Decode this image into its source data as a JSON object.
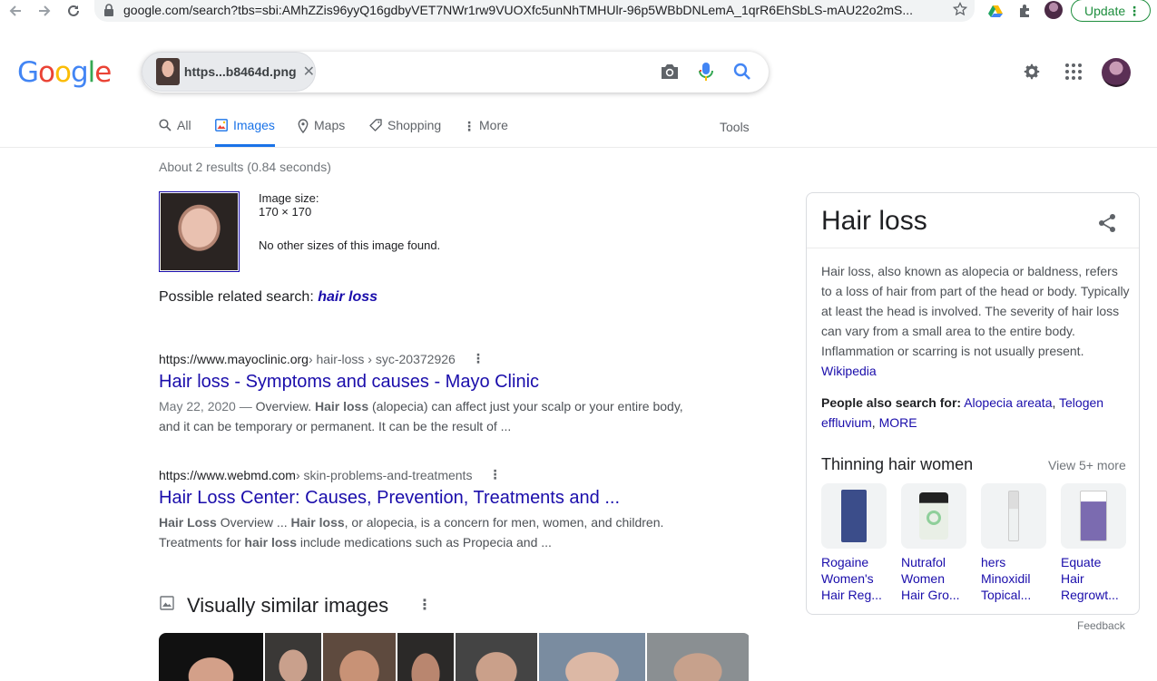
{
  "browser": {
    "url": "google.com/search?tbs=sbi:AMhZZis96yyQ16gdbyVET7NWr1rw9VUOXfc5unNhTMHUlr-96p5WBbDNLemA_1qrR6EhSbLS-mAU22o2mS...",
    "update_label": "Update"
  },
  "logo": [
    "G",
    "o",
    "o",
    "g",
    "l",
    "e"
  ],
  "logo_colors": [
    "#4285F4",
    "#EA4335",
    "#FBBC05",
    "#4285F4",
    "#34A853",
    "#EA4335"
  ],
  "search": {
    "chip_label": "https...b8464d.png"
  },
  "tabs": [
    {
      "label": "All",
      "icon": "search-icon"
    },
    {
      "label": "Images",
      "icon": "image-icon",
      "active": true
    },
    {
      "label": "Maps",
      "icon": "map-pin-icon"
    },
    {
      "label": "Shopping",
      "icon": "tag-icon"
    },
    {
      "label": "More",
      "icon": "kebab-icon"
    }
  ],
  "tools_label": "Tools",
  "result_stats": "About 2 results (0.84 seconds)",
  "query_image": {
    "size_label": "Image size:",
    "size_value": "170 × 170",
    "no_sizes": "No other sizes of this image found."
  },
  "related": {
    "prefix": "Possible related search: ",
    "query": "hair loss"
  },
  "results": [
    {
      "domain": "https://www.mayoclinic.org",
      "path": " › hair-loss › syc-20372926",
      "title": "Hair loss - Symptoms and causes - Mayo Clinic",
      "date": "May 22, 2020 — ",
      "snippet_1": "Overview. ",
      "snippet_bold_1": "Hair loss",
      "snippet_2": " (alopecia) can affect just your scalp or your entire body, and it can be temporary or permanent. It can be the result of ..."
    },
    {
      "domain": "https://www.webmd.com",
      "path": " › skin-problems-and-treatments",
      "title": "Hair Loss Center: Causes, Prevention, Treatments and ...",
      "snippet_bold_1": "Hair Loss",
      "snippet_1": " Overview ... ",
      "snippet_bold_2": "Hair loss",
      "snippet_2": ", or alopecia, is a concern for men, women, and children. Treatments for ",
      "snippet_bold_3": "hair loss",
      "snippet_3": " include medications such as Propecia and ..."
    }
  ],
  "visually_similar_title": "Visually similar images",
  "knowledge_panel": {
    "title": "Hair loss",
    "description": "Hair loss, also known as alopecia or baldness, refers to a loss of hair from part of the head or body. Typically at least the head is involved. The severity of hair loss can vary from a small area to the entire body. Inflammation or scarring is not usually present.",
    "source": "Wikipedia",
    "pas_label": "People also search for:",
    "pas_1": "Alopecia areata",
    "pas_2": "Telogen effluvium",
    "pas_more": "MORE",
    "sub_title": "Thinning hair women",
    "view_more": "View 5+ more",
    "products": [
      {
        "label": "Rogaine Women's Hair Reg..."
      },
      {
        "label": "Nutrafol Women Hair Gro..."
      },
      {
        "label": "hers Minoxidil Topical..."
      },
      {
        "label": "Equate Hair Regrowt..."
      }
    ]
  },
  "feedback": "Feedback"
}
